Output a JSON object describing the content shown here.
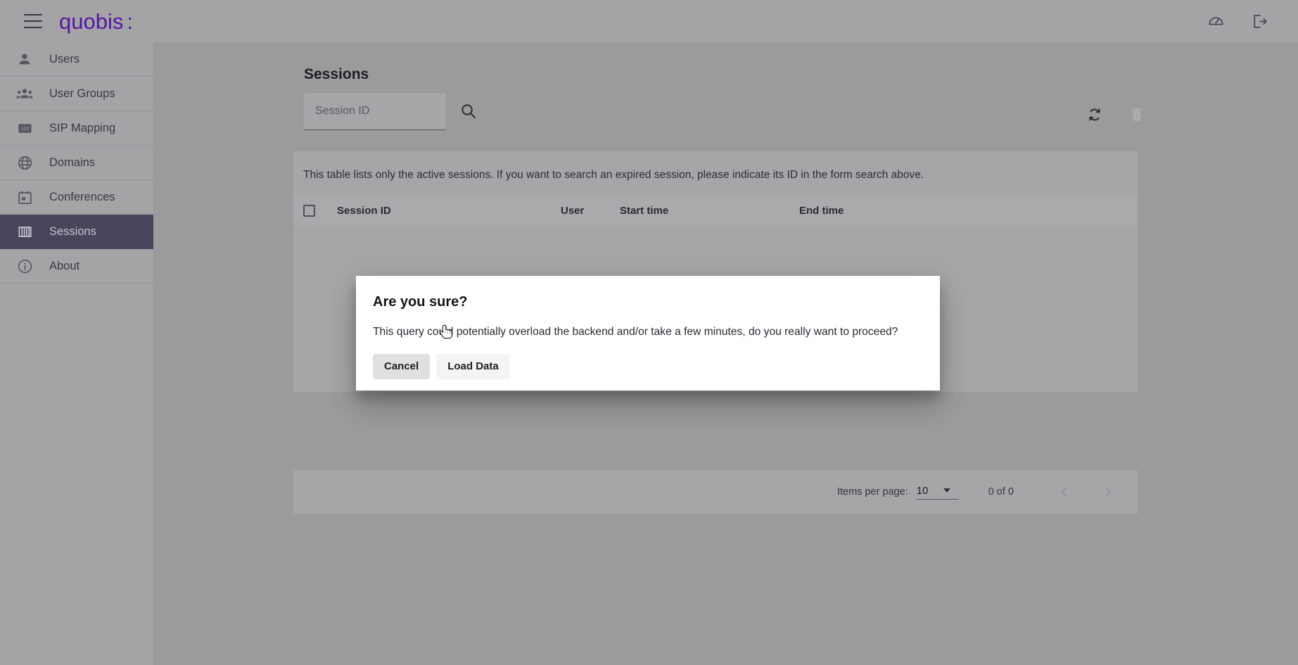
{
  "header": {
    "menu_icon": "hamburger-menu-icon",
    "logo_text": "quobis",
    "logo_colon": ":",
    "actions": [
      {
        "name": "dashboard-gauge-icon",
        "label": "Dashboard"
      },
      {
        "name": "logout-icon",
        "label": "Logout"
      }
    ]
  },
  "sidebar": {
    "items": [
      {
        "label": "Users",
        "icon": "person-icon",
        "active": false
      },
      {
        "label": "User Groups",
        "icon": "people-group-icon",
        "active": false
      },
      {
        "label": "SIP Mapping",
        "icon": "numeric-123-icon",
        "active": false
      },
      {
        "label": "Domains",
        "icon": "globe-icon",
        "active": false
      },
      {
        "label": "Conferences",
        "icon": "calendar-icon",
        "active": false
      },
      {
        "label": "Sessions",
        "icon": "columns-icon",
        "active": true
      },
      {
        "label": "About",
        "icon": "info-circle-icon",
        "active": false
      }
    ]
  },
  "main": {
    "title": "Sessions",
    "search": {
      "placeholder": "Session ID",
      "value": "",
      "button_icon": "search-icon"
    },
    "toolbar_actions": [
      {
        "name": "refresh-icon",
        "label": "Refresh",
        "disabled": false
      },
      {
        "name": "delete-icon",
        "label": "Delete",
        "disabled": true
      }
    ],
    "table_hint": "This table lists only the active sessions. If you want to search an expired session, please indicate its ID in the form search above.",
    "table": {
      "select_all_checkbox": "unchecked",
      "columns": [
        "Session ID",
        "User",
        "Start time",
        "End time"
      ],
      "rows": []
    },
    "paginator": {
      "items_per_page_label": "Items per page:",
      "items_per_page_value": "10",
      "range_label": "0 of 0",
      "prev_icon": "chevron-left-icon",
      "next_icon": "chevron-right-icon"
    }
  },
  "dialog": {
    "title": "Are you sure?",
    "message": "This query could potentially overload the backend and/or take a few minutes, do you really want to proceed?",
    "cancel_label": "Cancel",
    "confirm_label": "Load Data"
  },
  "colors": {
    "brand_purple": "#5918ad",
    "sidebar_active": "#4d4862",
    "page_background": "#a4a4a6",
    "card_background": "#b0b0b2",
    "dialog_background": "#ffffff"
  }
}
